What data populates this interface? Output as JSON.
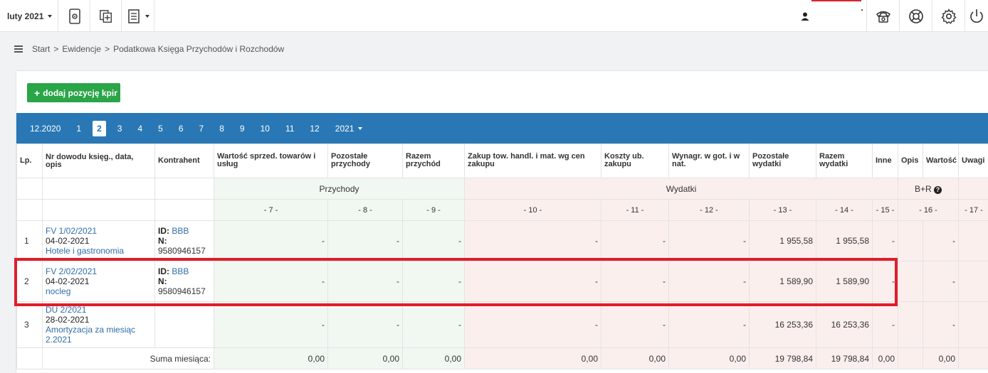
{
  "topbar": {
    "month_label": "luty 2021",
    "icons": [
      "calculator-icon",
      "add-document-icon",
      "list-document-icon"
    ],
    "right_icons": [
      "phone-icon",
      "lifebuoy-icon",
      "gear-icon",
      "power-icon"
    ]
  },
  "breadcrumb": {
    "items": [
      "Start",
      "Ewidencje",
      "Podatkowa Księga Przychodów i Rozchodów"
    ],
    "separator": ">"
  },
  "add_button": {
    "label": "dodaj pozycję kpir"
  },
  "months": {
    "prev": "12.2020",
    "items": [
      "1",
      "2",
      "3",
      "4",
      "5",
      "6",
      "7",
      "8",
      "9",
      "10",
      "11",
      "12"
    ],
    "active": "2",
    "year": "2021"
  },
  "table": {
    "headers": {
      "lp": "Lp.",
      "nr": "Nr dowodu księg., data, opis",
      "kontrahent": "Kontrahent",
      "c7": "Wartość sprzed. towarów i usług",
      "c8": "Pozostałe przychody",
      "c9": "Razem przychód",
      "c10": "Zakup tow. handl. i mat. wg cen zakupu",
      "c11": "Koszty ub. zakupu",
      "c12": "Wynagr. w got. i w nat.",
      "c13": "Pozostałe wydatki",
      "c14": "Razem wydatki",
      "c15": "Inne",
      "c16a": "Opis",
      "c16b": "Wartość",
      "c17": "Uwagi"
    },
    "groups": {
      "income": "Przychody",
      "expense": "Wydatki",
      "br": "B+R"
    },
    "col_numbers": [
      "- 7 -",
      "- 8 -",
      "- 9 -",
      "- 10 -",
      "- 11 -",
      "- 12 -",
      "- 13 -",
      "- 14 -",
      "- 15 -",
      "- 16 -",
      "- 17 -"
    ],
    "rows": [
      {
        "lp": "1",
        "doc": "FV 1/02/2021",
        "date": "04-02-2021",
        "desc": "Hotele i gastronomia",
        "id_label": "ID:",
        "id_value": "BBB",
        "n_label": "N:",
        "n_value": "9580946157",
        "c7": "-",
        "c8": "-",
        "c9": "-",
        "c10": "-",
        "c11": "-",
        "c12": "-",
        "c13": "1 955,58",
        "c14": "1 955,58",
        "c15": "-",
        "c16": "-"
      },
      {
        "lp": "2",
        "doc": "FV 2/02/2021",
        "date": "04-02-2021",
        "desc": "nocleg",
        "id_label": "ID:",
        "id_value": "BBB",
        "n_label": "N:",
        "n_value": "9580946157",
        "c7": "-",
        "c8": "-",
        "c9": "-",
        "c10": "-",
        "c11": "-",
        "c12": "-",
        "c13": "1 589,90",
        "c14": "1 589,90",
        "c15": "-",
        "c16": "-"
      },
      {
        "lp": "3",
        "doc": "DU 2/2021",
        "date": "28-02-2021",
        "desc": "Amortyzacja za miesiąc 2.2021",
        "c7": "-",
        "c8": "-",
        "c9": "-",
        "c10": "-",
        "c11": "-",
        "c12": "-",
        "c13": "16 253,36",
        "c14": "16 253,36",
        "c15": "-",
        "c16": "-"
      }
    ],
    "sum": {
      "label": "Suma miesiąca:",
      "c7": "0,00",
      "c8": "0,00",
      "c9": "0,00",
      "c10": "0,00",
      "c11": "0,00",
      "c12": "0,00",
      "c13": "19 798,84",
      "c14": "19 798,84",
      "c15": "0,00",
      "c16": "0,00"
    }
  },
  "colors": {
    "accent": "#2978b5",
    "add_button": "#2aa547",
    "income_bg": "#f1f8f1",
    "expense_bg": "#fbefee",
    "highlight": "#e01d2a",
    "link": "#2f6ea8"
  }
}
